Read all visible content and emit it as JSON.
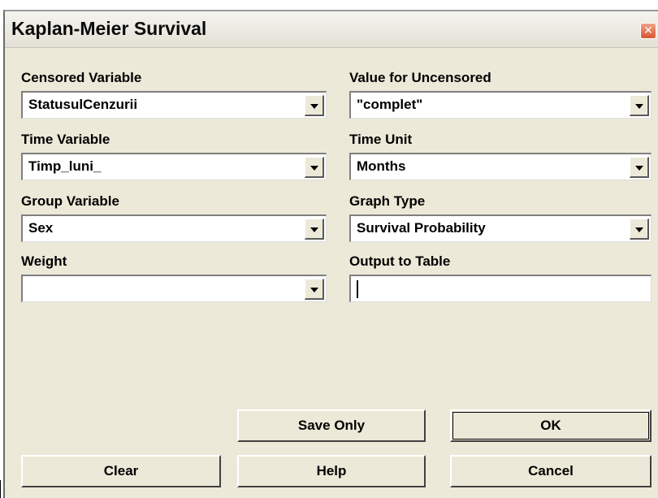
{
  "window": {
    "title": "Kaplan-Meier Survival"
  },
  "fields": {
    "censored_variable": {
      "label": "Censored Variable",
      "value": "StatusulCenzurii"
    },
    "value_for_uncensored": {
      "label": "Value for Uncensored",
      "value": "\"complet\""
    },
    "time_variable": {
      "label": "Time Variable",
      "value": "Timp_luni_"
    },
    "time_unit": {
      "label": "Time Unit",
      "value": "Months"
    },
    "group_variable": {
      "label": "Group Variable",
      "value": "Sex"
    },
    "graph_type": {
      "label": "Graph Type",
      "value": "Survival Probability"
    },
    "weight": {
      "label": "Weight",
      "value": ""
    },
    "output_to_table": {
      "label": "Output to Table",
      "value": ""
    }
  },
  "buttons": {
    "save_only": "Save Only",
    "ok": "OK",
    "clear": "Clear",
    "help": "Help",
    "cancel": "Cancel"
  },
  "icons": {
    "close": "close-icon",
    "dropdown": "chevron-down-icon"
  }
}
